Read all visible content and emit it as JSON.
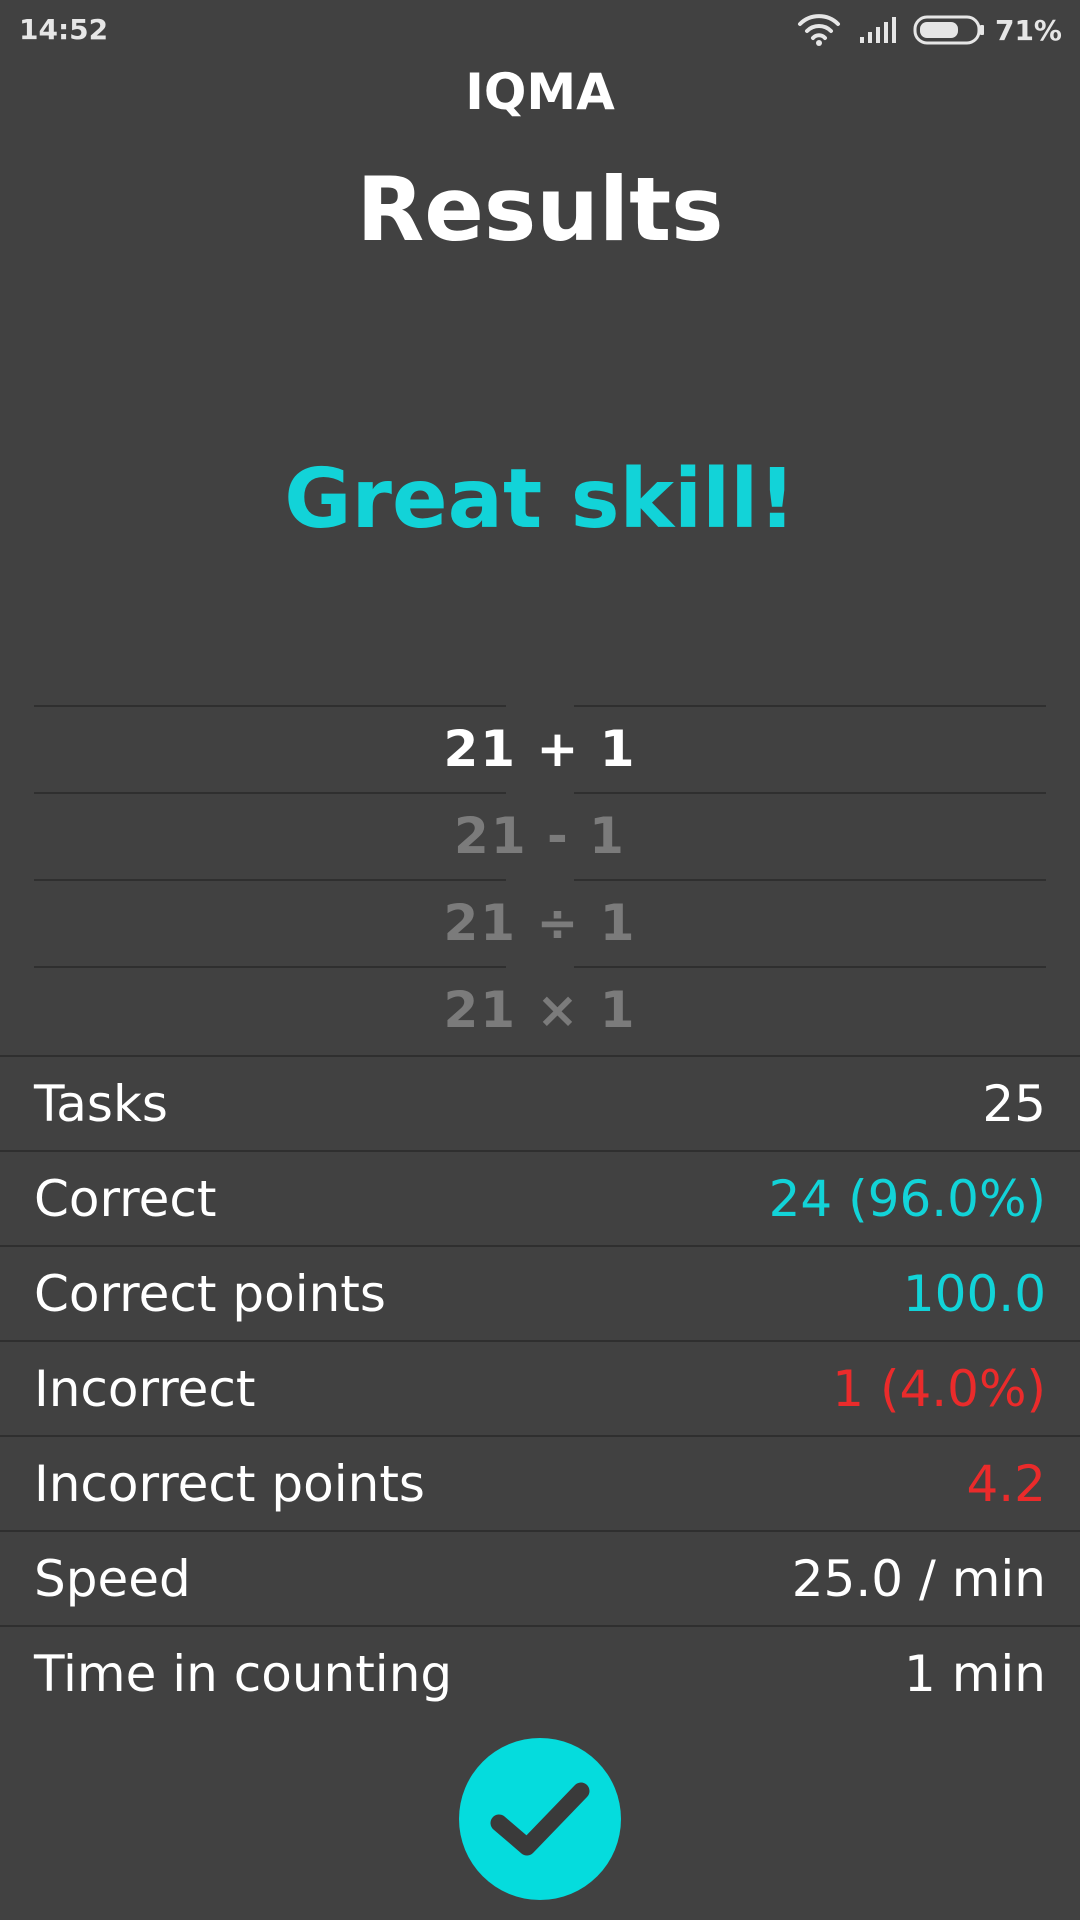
{
  "status_bar": {
    "time": "14:52",
    "battery_percent": "71%",
    "battery_level": 0.71,
    "icons": [
      "wifi-icon",
      "signal-icon",
      "battery-icon"
    ]
  },
  "header": {
    "app_title": "IQMA",
    "page_title": "Results"
  },
  "rating": {
    "text": "Great skill!",
    "color": "#12d3d8"
  },
  "operations": [
    {
      "text": "21 + 1",
      "color": "#ffffff",
      "selected": true
    },
    {
      "text": "21 - 1",
      "color": "#7b7b7b",
      "selected": false
    },
    {
      "text": "21 ÷ 1",
      "color": "#7b7b7b",
      "selected": false
    },
    {
      "text": "21 × 1",
      "color": "#7b7b7b",
      "selected": false
    }
  ],
  "stats": [
    {
      "label": "Tasks",
      "value": "25",
      "color": "#ffffff"
    },
    {
      "label": "Correct",
      "value": "24 (96.0%)",
      "color": "#12d3d8"
    },
    {
      "label": "Correct points",
      "value": "100.0",
      "color": "#12d3d8"
    },
    {
      "label": "Incorrect",
      "value": "1 (4.0%)",
      "color": "#ea2b2b"
    },
    {
      "label": "Incorrect points",
      "value": "4.2",
      "color": "#ea2b2b"
    },
    {
      "label": "Speed",
      "value": "25.0 / min",
      "color": "#ffffff"
    },
    {
      "label": "Time in counting",
      "value": "1 min",
      "color": "#ffffff"
    }
  ],
  "done_button": {
    "icon": "checkmark-icon",
    "color": "#05dcdd"
  },
  "colors": {
    "background": "#414141",
    "divider": "#2f2f2f",
    "accent": "#12d3d8",
    "error": "#ea2b2b"
  }
}
